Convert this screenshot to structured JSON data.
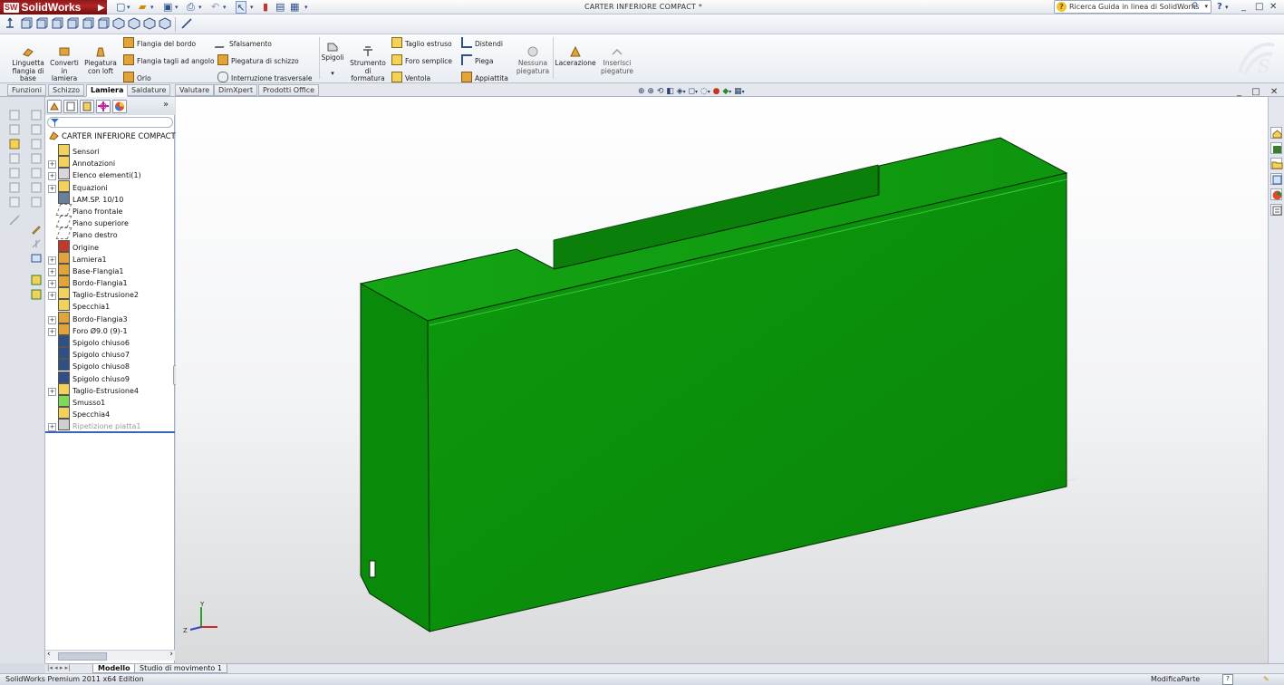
{
  "app": {
    "name": "SolidWorks",
    "document_title": "CARTER INFERIORE COMPACT *",
    "help_search_placeholder": "Ricerca Guida in linea di SolidWorks",
    "help_question": "?",
    "window_controls": [
      "_",
      "□",
      "✕"
    ],
    "doc_window_controls": [
      "_",
      "□",
      "✕"
    ]
  },
  "ribbon": {
    "big_buttons": [
      {
        "label": "Linguetta flangia di base",
        "icon": "base-flange-icon"
      },
      {
        "label": "Converti in lamiera",
        "icon": "convert-sheetmetal-icon"
      },
      {
        "label": "Piegatura con loft",
        "icon": "lofted-bend-icon"
      }
    ],
    "col1": [
      "Flangia del bordo",
      "Flangia tagli ad angolo",
      "Orlo"
    ],
    "col2": [
      "Sfalsamento",
      "Piegatura di schizzo",
      "Interruzione trasversale"
    ],
    "spigoli": "Spigoli",
    "strumento": "Strumento di formatura",
    "col3": [
      "Taglio estruso",
      "Foro semplice",
      "Ventola"
    ],
    "col4": [
      "Distendi",
      "Piega",
      "Appiattita"
    ],
    "nessuna": "Nessuna piegatura",
    "lacerazione": "Lacerazione",
    "inserisci": "Inserisci piegature"
  },
  "tabs": [
    "Funzioni",
    "Schizzo",
    "Lamiera",
    "Saldature",
    "Valutare",
    "DimXpert",
    "Prodotti Office"
  ],
  "active_tab": "Lamiera",
  "tree": {
    "root": "CARTER INFERIORE COMPACT",
    "items": [
      {
        "label": "Sensori",
        "expandable": false,
        "icon": "sensor-icon"
      },
      {
        "label": "Annotazioni",
        "expandable": true,
        "icon": "annotation-icon"
      },
      {
        "label": "Elenco elementi(1)",
        "expandable": true,
        "icon": "cutlist-icon"
      },
      {
        "label": "Equazioni",
        "expandable": true,
        "icon": "equation-icon"
      },
      {
        "label": "LAM.SP. 10/10",
        "expandable": false,
        "icon": "material-icon"
      },
      {
        "label": "Piano frontale",
        "expandable": false,
        "icon": "plane-icon"
      },
      {
        "label": "Piano superiore",
        "expandable": false,
        "icon": "plane-icon"
      },
      {
        "label": "Piano destro",
        "expandable": false,
        "icon": "plane-icon"
      },
      {
        "label": "Origine",
        "expandable": false,
        "icon": "origin-icon"
      },
      {
        "label": "Lamiera1",
        "expandable": true,
        "icon": "sheetmetal-icon"
      },
      {
        "label": "Base-Flangia1",
        "expandable": true,
        "icon": "base-flange-icon"
      },
      {
        "label": "Bordo-Flangia1",
        "expandable": true,
        "icon": "edge-flange-icon"
      },
      {
        "label": "Taglio-Estrusione2",
        "expandable": true,
        "icon": "extruded-cut-icon"
      },
      {
        "label": "Specchia1",
        "expandable": false,
        "icon": "mirror-icon"
      },
      {
        "label": "Bordo-Flangia3",
        "expandable": true,
        "icon": "edge-flange-icon"
      },
      {
        "label": "Foro Ø9.0 (9)-1",
        "expandable": true,
        "icon": "hole-icon"
      },
      {
        "label": "Spigolo chiuso6",
        "expandable": false,
        "icon": "closed-corner-icon"
      },
      {
        "label": "Spigolo chiuso7",
        "expandable": false,
        "icon": "closed-corner-icon"
      },
      {
        "label": "Spigolo chiuso8",
        "expandable": false,
        "icon": "closed-corner-icon"
      },
      {
        "label": "Spigolo chiuso9",
        "expandable": false,
        "icon": "closed-corner-icon"
      },
      {
        "label": "Taglio-Estrusione4",
        "expandable": true,
        "icon": "extruded-cut-icon"
      },
      {
        "label": "Smusso1",
        "expandable": false,
        "icon": "chamfer-icon"
      },
      {
        "label": "Specchia4",
        "expandable": false,
        "icon": "mirror-icon"
      },
      {
        "label": "Ripetizione piatta1",
        "expandable": true,
        "icon": "flat-pattern-icon",
        "suppressed": true
      }
    ]
  },
  "bottom_tabs": [
    "Modello",
    "Studio di movimento 1"
  ],
  "status": {
    "left": "SolidWorks Premium 2011 x64 Edition",
    "right": "ModificaParte",
    "help": "?"
  },
  "triad": {
    "y": "Y",
    "z": "Z"
  },
  "colors": {
    "part_green": "#0a8d0a",
    "part_green_light": "#12a812",
    "part_green_dark": "#076b07",
    "brand_red": "#b32525"
  }
}
